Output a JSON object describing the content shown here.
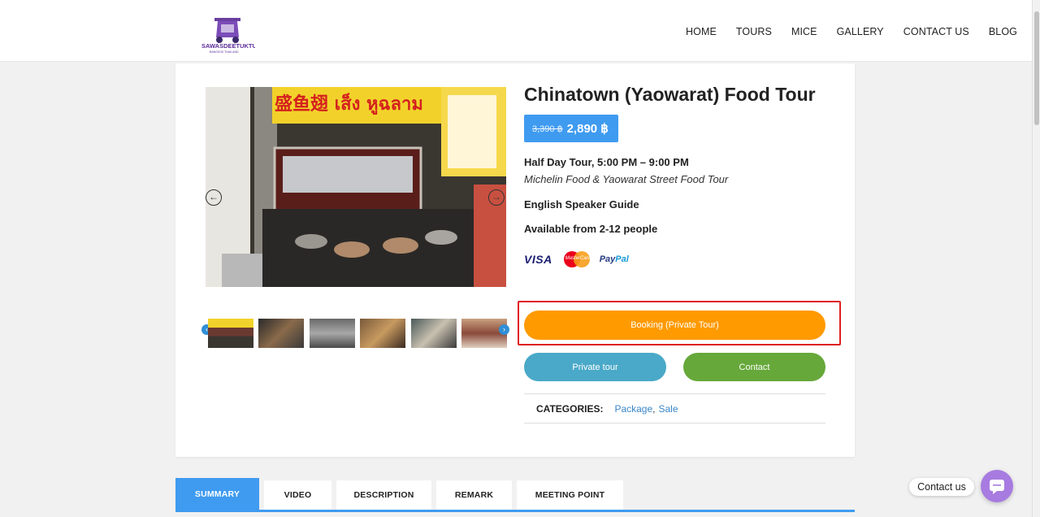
{
  "brand": {
    "name": "SAWASDEETUKTUK",
    "tagline": "BANGKOK THAILAND"
  },
  "nav": [
    "HOME",
    "TOURS",
    "MICE",
    "GALLERY",
    "CONTACT US",
    "BLOG"
  ],
  "tour": {
    "title": "Chinatown (Yaowarat) Food Tour",
    "old_price": "3,390 ฿",
    "price": "2,890 ฿",
    "duration": "Half Day Tour, 5:00 PM – 9:00 PM",
    "subtitle": "Michelin Food & Yaowarat Street Food Tour",
    "guide": "English Speaker Guide",
    "availability": "Available from 2-12 people",
    "payments": {
      "visa": "VISA",
      "mastercard": "MasterCard",
      "paypal_a": "Pay",
      "paypal_b": "Pal"
    }
  },
  "buttons": {
    "booking": "Booking (Private Tour)",
    "private": "Private tour",
    "contact": "Contact"
  },
  "categories": {
    "label": "CATEGORIES:",
    "items": [
      "Package",
      "Sale"
    ],
    "separator": ","
  },
  "sign_text": "盛鱼翅 เส็ง หูฉลาม",
  "tabs": [
    "SUMMARY",
    "VIDEO",
    "DESCRIPTION",
    "REMARK",
    "MEETING POINT"
  ],
  "widget": {
    "label": "Contact us"
  },
  "colors": {
    "accent": "#3f9bf0",
    "booking": "#ff9a00",
    "private": "#4aa9c8",
    "contact": "#66a83a",
    "highlight": "#e02020",
    "chat": "#a77be0"
  }
}
